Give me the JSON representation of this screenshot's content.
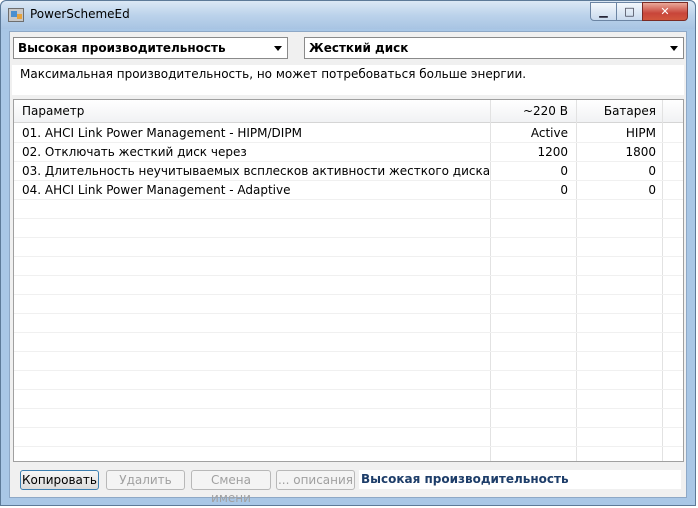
{
  "window": {
    "title": "PowerSchemeEd",
    "minimize_glyph": "▁",
    "maximize_glyph": "□",
    "close_glyph": "✕"
  },
  "scheme_select": {
    "value": "Высокая производительность"
  },
  "category_select": {
    "value": "Жесткий диск"
  },
  "description": "Максимальная производительность, но может потребоваться больше энергии.",
  "table": {
    "columns": [
      "Параметр",
      "~220 В",
      "Батарея"
    ],
    "rows": [
      {
        "name": "01. AHCI Link Power Management - HIPM/DIPM",
        "ac": "Active",
        "battery": "HIPM"
      },
      {
        "name": "02. Отключать жесткий диск через",
        "ac": "1200",
        "battery": "1800"
      },
      {
        "name": "03. Длительность неучитываемых всплесков активности жесткого диска",
        "ac": "0",
        "battery": "0"
      },
      {
        "name": "04. AHCI Link Power Management - Adaptive",
        "ac": "0",
        "battery": "0"
      }
    ]
  },
  "buttons": {
    "copy": "Копировать",
    "delete": "Удалить",
    "rename": "Смена имени",
    "description": "... описания"
  },
  "current_scheme": "Высокая производительность",
  "colors": {
    "frame": "#a9c7e6",
    "scheme_text": "#1d3d69"
  }
}
